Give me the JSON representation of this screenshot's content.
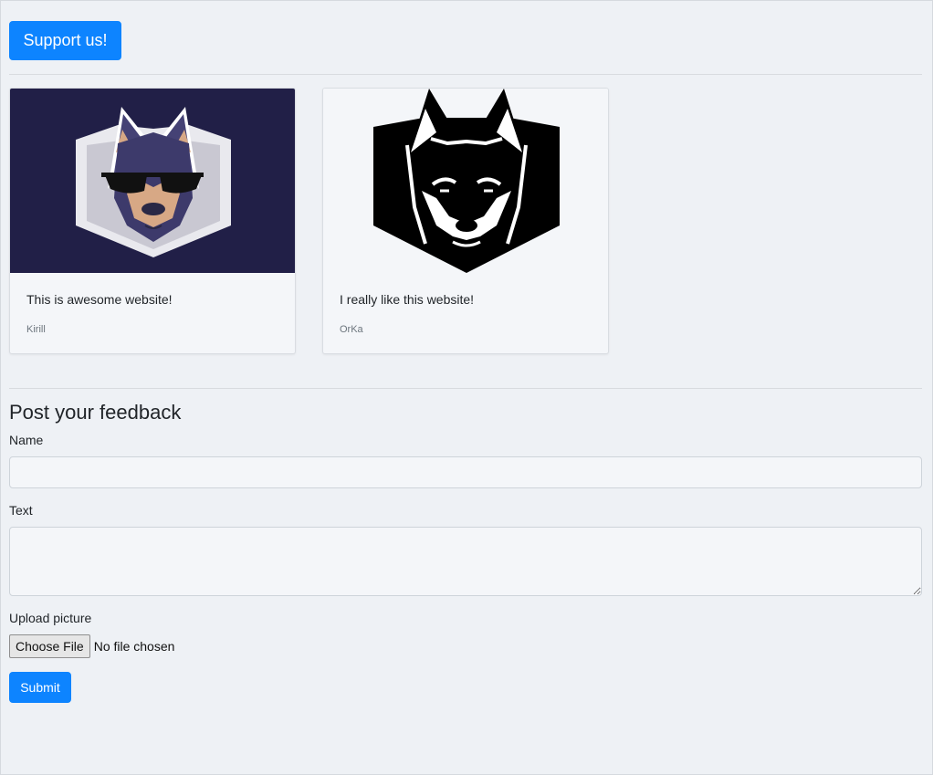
{
  "support_button": "Support us!",
  "feedback_cards": [
    {
      "text": "This is awesome website!",
      "author": "Kirill"
    },
    {
      "text": "I really like this website!",
      "author": "OrKa"
    }
  ],
  "form": {
    "heading": "Post your feedback",
    "name_label": "Name",
    "name_value": "",
    "text_label": "Text",
    "text_value": "",
    "upload_label": "Upload picture",
    "choose_file": "Choose File",
    "file_status": "No file chosen",
    "submit": "Submit"
  },
  "colors": {
    "primary": "#0d84ff",
    "background": "#eef1f5",
    "card_dark": "#211f47"
  }
}
